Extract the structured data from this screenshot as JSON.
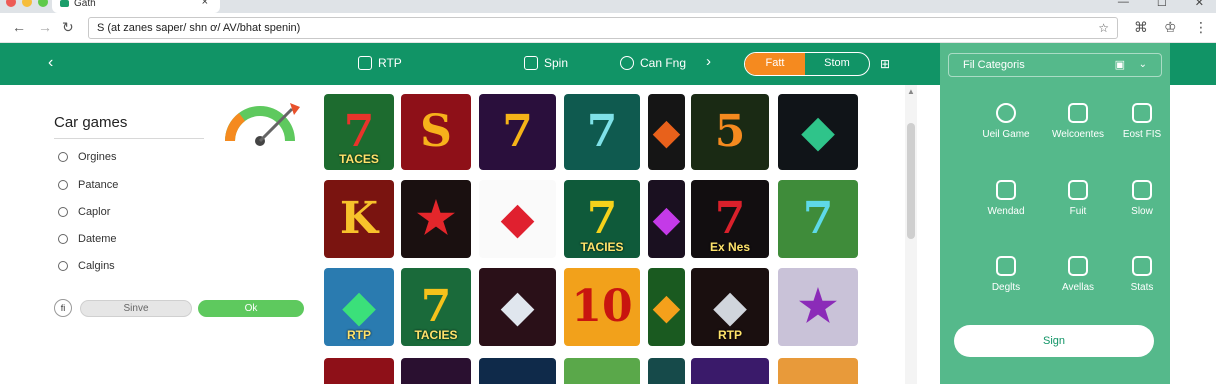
{
  "browser": {
    "tab_title": "Gath",
    "tab_close": "×",
    "url": "S (at zanes saper/ shn ơ/ AV/bhat spenin)",
    "window_controls": [
      "—",
      "☐",
      "✕"
    ],
    "right_icons": [
      "⌘",
      "♔",
      "⋮"
    ]
  },
  "header": {
    "back": "‹",
    "items": [
      {
        "label": "RTP",
        "icon": "home-icon"
      },
      {
        "label": "Spin",
        "icon": "document-icon"
      },
      {
        "label": "Can Fng",
        "icon": "refresh-icon"
      }
    ],
    "chevron": "›",
    "toggle": {
      "active": "Fatt",
      "inactive": "Stom"
    },
    "grid_icon": "⊞"
  },
  "left_panel": {
    "title": "Car games",
    "options": [
      "Orgines",
      "Patance",
      "Caplor",
      "Dateme",
      "Calgins"
    ],
    "info": "fi",
    "save_label": "Sinve",
    "ok_label": "Ok"
  },
  "games": [
    {
      "glyph": "7",
      "caption": "TACES",
      "bg": "#1d6b2f",
      "fg": "#e8342b"
    },
    {
      "glyph": "S",
      "caption": "",
      "bg": "#8e1018",
      "fg": "#f7b21b"
    },
    {
      "glyph": "7",
      "caption": "",
      "bg": "#2a0f3c",
      "fg": "#f5b318"
    },
    {
      "glyph": "7",
      "caption": "",
      "bg": "#0f5a4f",
      "fg": "#7fe1e8"
    },
    {
      "glyph": "◆",
      "caption": "",
      "bg": "#151515",
      "fg": "#e8611b"
    },
    {
      "glyph": "5",
      "caption": "",
      "bg": "#1a2a14",
      "fg": "#f58a1f"
    },
    {
      "glyph": "◆",
      "caption": "",
      "bg": "#101418",
      "fg": "#2fc48a"
    },
    {
      "glyph": "K",
      "caption": "",
      "bg": "#7a1410",
      "fg": "#f7c22b"
    },
    {
      "glyph": "★",
      "caption": "",
      "bg": "#1a1010",
      "fg": "#e4262b"
    },
    {
      "glyph": "◆",
      "caption": "",
      "bg": "#fafafa",
      "fg": "#e0202f"
    },
    {
      "glyph": "7",
      "caption": "TACIES",
      "bg": "#0f5a3a",
      "fg": "#f5d21b"
    },
    {
      "glyph": "◆",
      "caption": "",
      "bg": "#1a1020",
      "fg": "#c43ae8"
    },
    {
      "glyph": "7",
      "caption": "Ex Nes",
      "bg": "#120e10",
      "fg": "#d9202b"
    },
    {
      "glyph": "7",
      "caption": "",
      "bg": "#3f8c3a",
      "fg": "#5ed9e8"
    },
    {
      "glyph": "◆",
      "caption": "RTP",
      "bg": "#2a7bb0",
      "fg": "#3be07a"
    },
    {
      "glyph": "7",
      "caption": "TACIES",
      "bg": "#1a6a3a",
      "fg": "#f5c21b"
    },
    {
      "glyph": "◆",
      "caption": "",
      "bg": "#2a1018",
      "fg": "#e0e6ee"
    },
    {
      "glyph": "10",
      "caption": "",
      "bg": "#f2a11b",
      "fg": "#c8150f"
    },
    {
      "glyph": "◆",
      "caption": "",
      "bg": "#1a5a20",
      "fg": "#f5a01b"
    },
    {
      "glyph": "◆",
      "caption": "RTP",
      "bg": "#1a0f0f",
      "fg": "#d0d5dc"
    },
    {
      "glyph": "★",
      "caption": "",
      "bg": "#c9c2d8",
      "fg": "#8b2bb8"
    },
    {
      "glyph": "",
      "caption": "",
      "bg": "#8e1018",
      "fg": "#f5c21b"
    },
    {
      "glyph": "",
      "caption": "",
      "bg": "#2a1030",
      "fg": "#e83a8b"
    },
    {
      "glyph": "",
      "caption": "",
      "bg": "#0f2a4a",
      "fg": "#5ec0ff"
    },
    {
      "glyph": "",
      "caption": "",
      "bg": "#5aa84a",
      "fg": "#ffffff"
    },
    {
      "glyph": "",
      "caption": "",
      "bg": "#164a4a",
      "fg": "#ffffff"
    },
    {
      "glyph": "",
      "caption": "",
      "bg": "#3a1a6a",
      "fg": "#ffffff"
    },
    {
      "glyph": "",
      "caption": "",
      "bg": "#e89a3a",
      "fg": "#ffffff"
    }
  ],
  "right_panel": {
    "header_label": "Fil Categoris",
    "header_icon": "▣",
    "header_chevron": "⌄",
    "items": [
      {
        "label": "Ueil Game",
        "icon": "globe-icon"
      },
      {
        "label": "Welcoentes",
        "icon": "stack-icon"
      },
      {
        "label": "Eost FIS",
        "icon": "grid-icon"
      },
      {
        "label": "Wendad",
        "icon": "wand-icon"
      },
      {
        "label": "Fuit",
        "icon": "dice-icon"
      },
      {
        "label": "Slow",
        "icon": "tag-icon"
      },
      {
        "label": "Deglts",
        "icon": "panel-icon"
      },
      {
        "label": "Avellas",
        "icon": "bottle-icon"
      },
      {
        "label": "Stats",
        "icon": "dots-icon"
      }
    ],
    "signin_label": "Sign"
  }
}
